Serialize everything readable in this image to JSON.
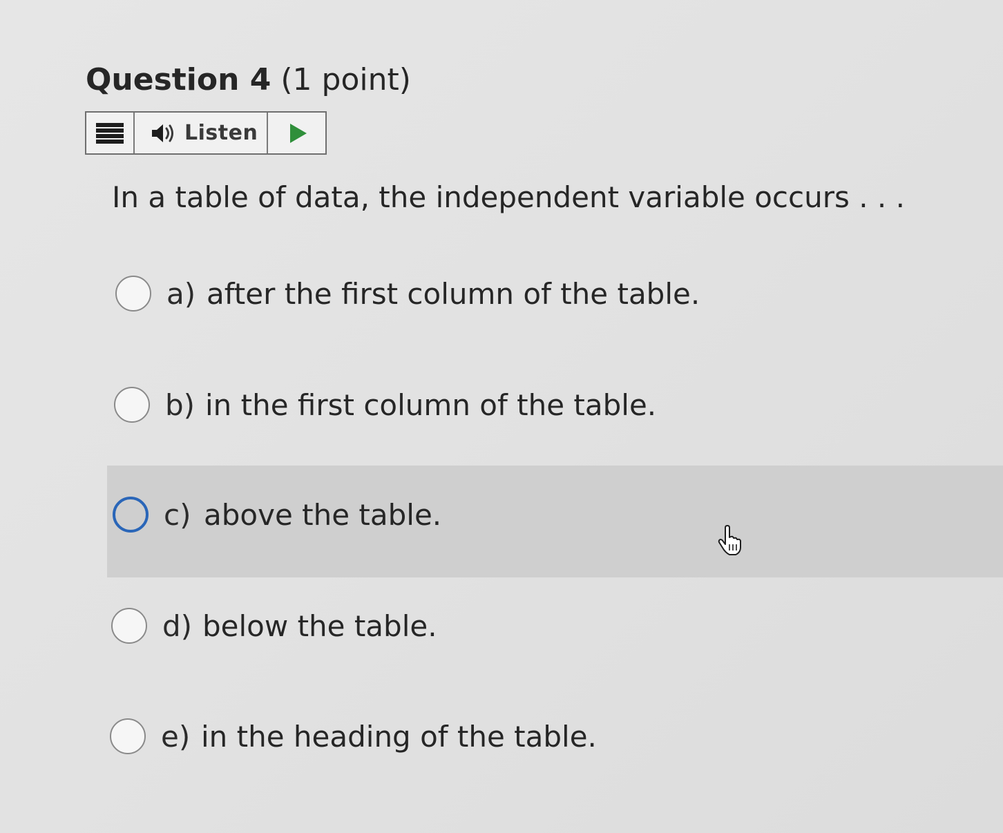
{
  "question": {
    "number_label": "Question 4",
    "points_label": "(1 point)",
    "prompt": "In a table of data, the independent variable occurs . . ."
  },
  "toolbar": {
    "menu_icon": "hamburger-menu-icon",
    "listen_icon": "speaker-icon",
    "listen_label": "Listen",
    "play_icon": "play-icon",
    "play_color": "#2f8f3a"
  },
  "options": [
    {
      "letter": "a)",
      "text": "after the first column of the table.",
      "focused": false
    },
    {
      "letter": "b)",
      "text": "in the first column of the table.",
      "focused": false
    },
    {
      "letter": "c)",
      "text": "above the table.",
      "focused": true
    },
    {
      "letter": "d)",
      "text": "below the table.",
      "focused": false
    },
    {
      "letter": "e)",
      "text": "in the heading of the table.",
      "focused": false
    }
  ],
  "colors": {
    "focus_ring": "#2a66b8",
    "hover_row": "#cfcfcf"
  }
}
